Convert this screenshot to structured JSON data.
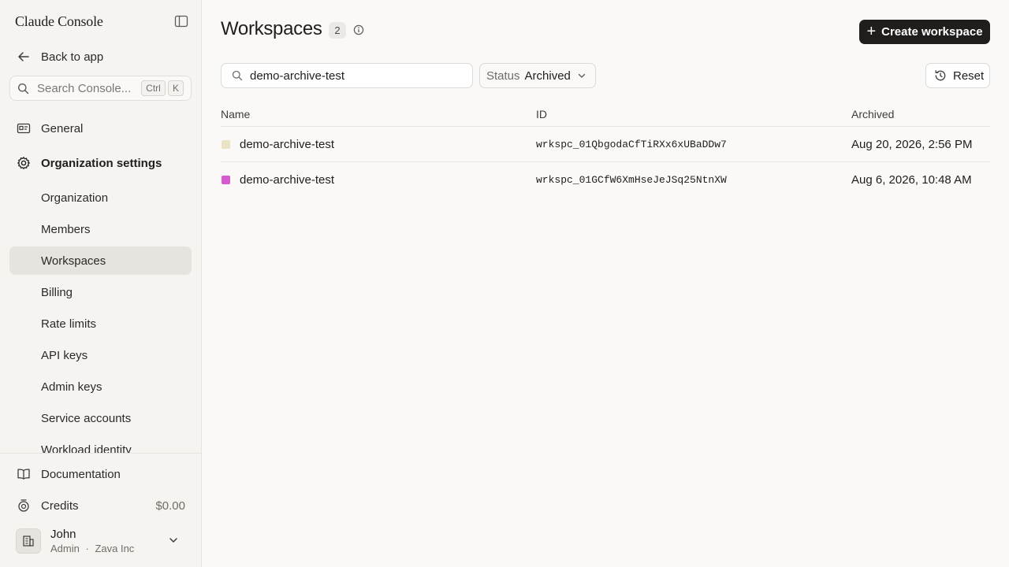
{
  "sidebar": {
    "brand": "Claude Console",
    "back_label": "Back to app",
    "search": {
      "placeholder": "Search Console...",
      "kbd_ctrl": "Ctrl",
      "kbd_k": "K"
    },
    "nav": {
      "general": "General",
      "org_settings": "Organization settings",
      "sub_items": [
        "Organization",
        "Members",
        "Workspaces",
        "Billing",
        "Rate limits",
        "API keys",
        "Admin keys",
        "Service accounts",
        "Workload identity"
      ],
      "active_sub_item": "Workspaces"
    },
    "bottom": {
      "documentation": "Documentation",
      "credits_label": "Credits",
      "credits_value": "$0.00"
    },
    "user": {
      "name": "John",
      "role": "Admin",
      "separator": "·",
      "org": "Zava Inc"
    }
  },
  "header": {
    "title": "Workspaces",
    "count": "2",
    "create_label": "Create workspace"
  },
  "filters": {
    "search_value": "demo-archive-test",
    "status_key": "Status",
    "status_value": "Archived",
    "reset_label": "Reset"
  },
  "table": {
    "columns": [
      "Name",
      "ID",
      "Archived"
    ],
    "rows": [
      {
        "name": "demo-archive-test",
        "id": "wrkspc_01QbgodaCfTiRXx6xUBaDDw7",
        "archived": "Aug 20, 2026, 2:56 PM",
        "color": "#eae3c4"
      },
      {
        "name": "demo-archive-test",
        "id": "wrkspc_01GCfW6XmHseJeJSq25NtnXW",
        "archived": "Aug 6, 2026, 10:48 AM",
        "color": "#d65bd0"
      }
    ]
  },
  "icons": {
    "panel_toggle": "sidebar-panel-icon",
    "back": "arrow-left-icon",
    "search": "search-icon",
    "general": "id-card-icon",
    "org_settings": "gear-icon",
    "documentation": "book-icon",
    "credits": "coin-icon",
    "avatar": "building-icon",
    "info": "info-icon",
    "reset": "history-icon"
  }
}
